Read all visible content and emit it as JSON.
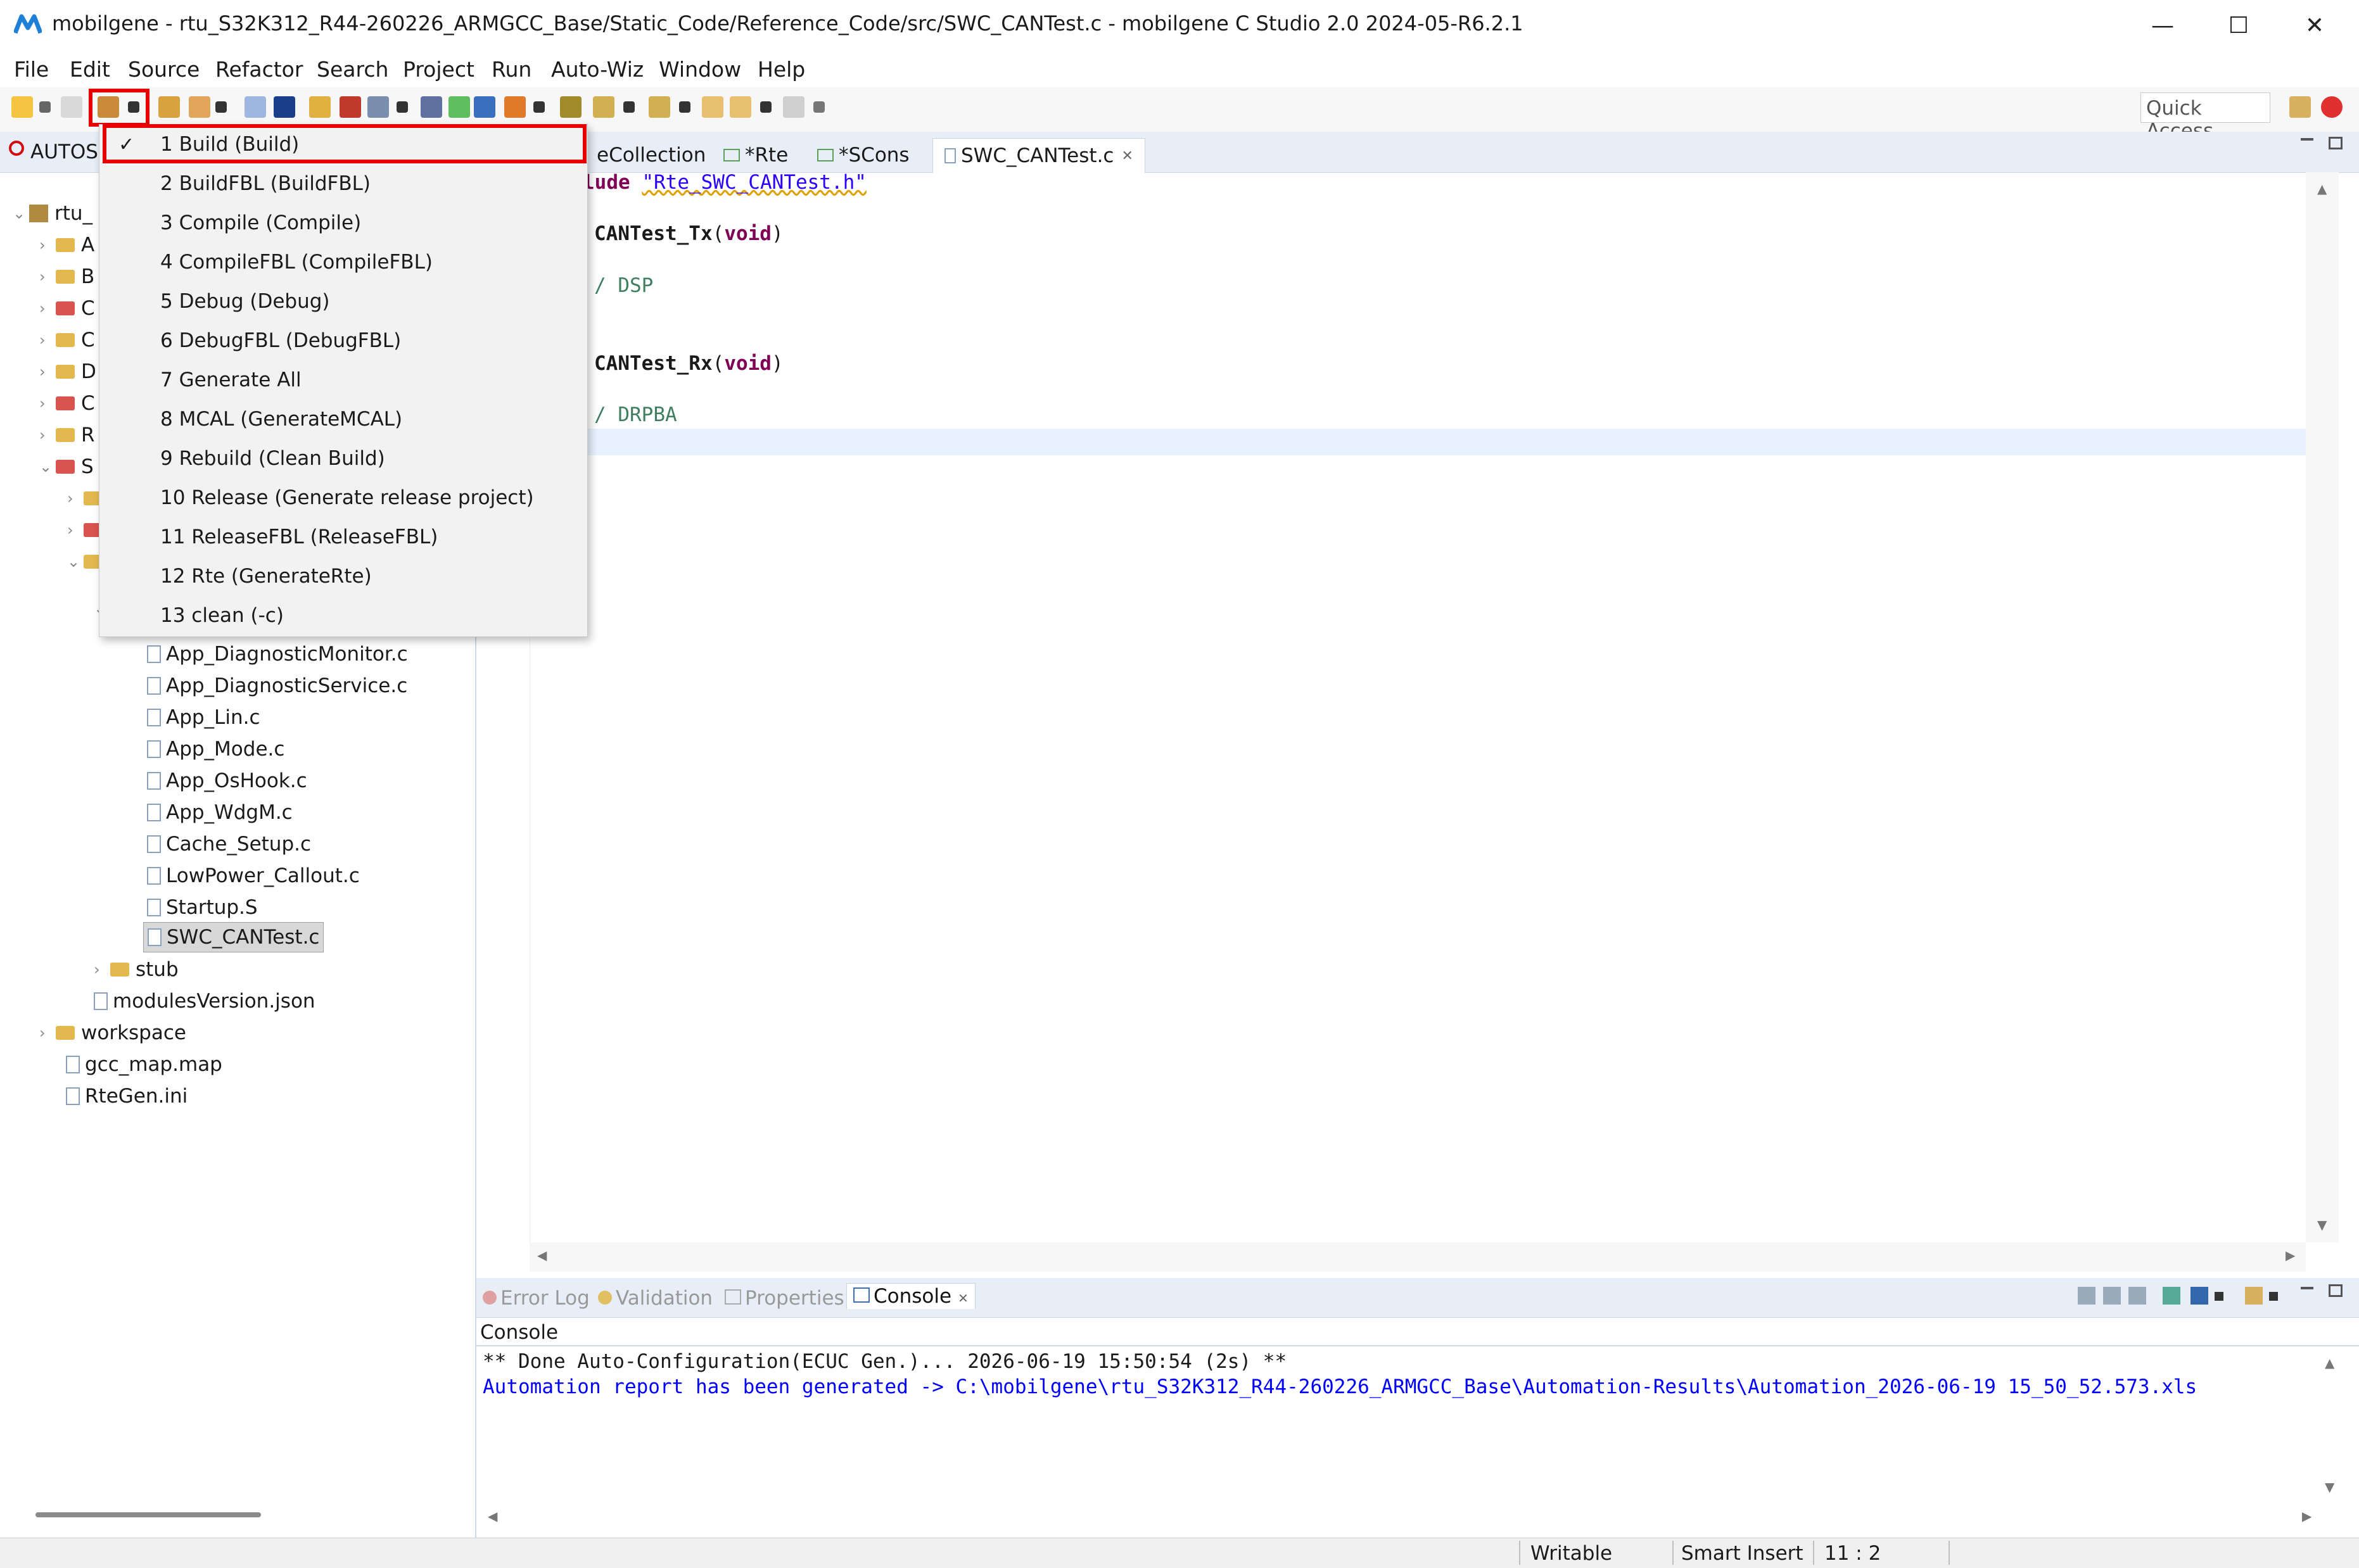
{
  "window": {
    "title": "mobilgene - rtu_S32K312_R44-260226_ARMGCC_Base/Static_Code/Reference_Code/src/SWC_CANTest.c - mobilgene C Studio 2.0 2024-05-R6.2.1",
    "minimize": "—",
    "maximize": "☐",
    "close": "✕"
  },
  "menu": [
    "File",
    "Edit",
    "Source",
    "Refactor",
    "Search",
    "Project",
    "Run",
    "Auto-Wiz",
    "Window",
    "Help"
  ],
  "toolbar": {
    "quick_access": "Quick Access"
  },
  "left_panel": {
    "tab": "AUTOS",
    "tree": [
      "rtu_",
      "A",
      "B",
      "C",
      "C",
      "D",
      "C",
      "R",
      "S",
      "App_DiagnosticMonitor.c",
      "App_DiagnosticService.c",
      "App_Lin.c",
      "App_Mode.c",
      "App_OsHook.c",
      "App_WdgM.c",
      "Cache_Setup.c",
      "LowPower_Callout.c",
      "Startup.S",
      "SWC_CANTest.c",
      "stub",
      "modulesVersion.json",
      "workspace",
      "gcc_map.map",
      "RteGen.ini"
    ]
  },
  "editor_tabs": [
    "eCollection",
    "*Rte",
    "*SCons",
    "SWC_CANTest.c"
  ],
  "editor_tab_close": "✕",
  "code": {
    "l1a": "lude ",
    "l1b": "\"Rte_SWC_CANTest.h\"",
    "l2a": "CANTest_Tx",
    "l2b": "(",
    "l2c": "void",
    "l2d": ")",
    "l3": "/ DSP",
    "l4a": "CANTest_Rx",
    "l4b": "(",
    "l4c": "void",
    "l4d": ")",
    "l5": "/ DRPBA"
  },
  "build_menu": {
    "check": "✓",
    "items": [
      "1 Build (Build)",
      "2 BuildFBL (BuildFBL)",
      "3 Compile (Compile)",
      "4 CompileFBL (CompileFBL)",
      "5 Debug (Debug)",
      "6 DebugFBL (DebugFBL)",
      "7 Generate All",
      "8 MCAL (GenerateMCAL)",
      "9 Rebuild (Clean  Build)",
      "10 Release (Generate release project)",
      "11 ReleaseFBL (ReleaseFBL)",
      "12 Rte (GenerateRte)",
      "13 clean (-c)"
    ]
  },
  "bottom_tabs": [
    "Error Log",
    "Validation",
    "Properties",
    "Console"
  ],
  "console": {
    "header": "Console",
    "line1": "** Done Auto-Configuration(ECUC Gen.)... 2026-06-19 15:50:54 (2s) **",
    "line2": "Automation report has been generated -> C:\\mobilgene\\rtu_S32K312_R44-260226_ARMGCC_Base\\Automation-Results\\Automation_2026-06-19 15_50_52.573.xls"
  },
  "status": {
    "writable": "Writable",
    "insert": "Smart Insert",
    "position": "11 : 2"
  },
  "colors": {
    "highlight_box": "#e60000",
    "keyword": "#7f0055",
    "string": "#2a00ff",
    "comment": "#3f7f5f",
    "console_link": "#0000ff"
  }
}
